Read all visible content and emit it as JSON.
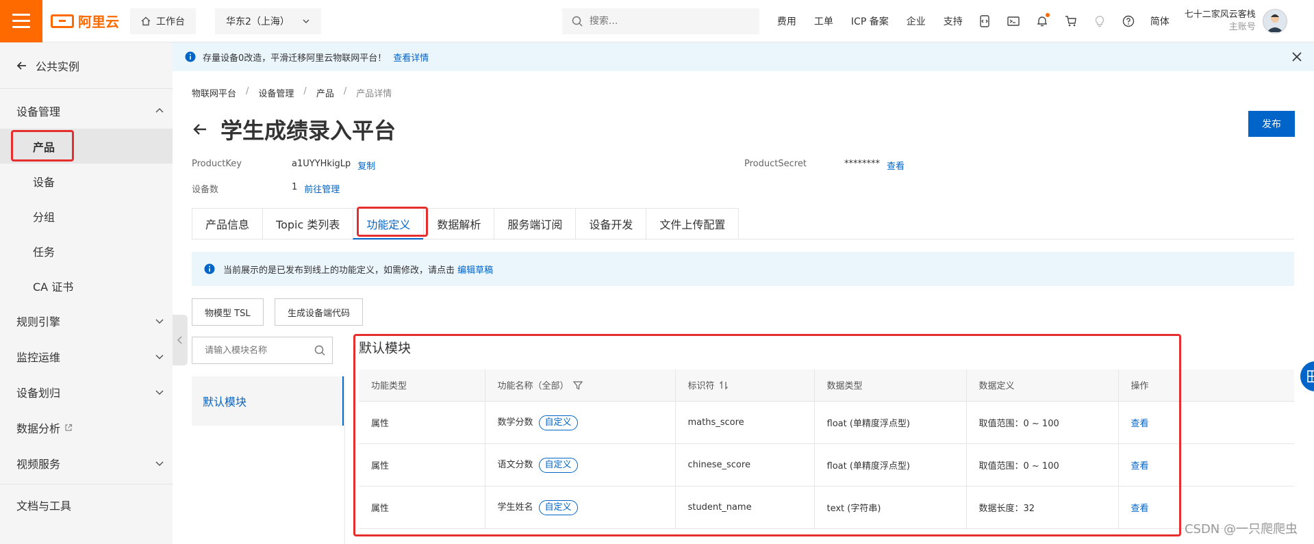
{
  "header": {
    "logo_text": "阿里云",
    "workbench_label": "工作台",
    "region_label": "华东2（上海）",
    "search_placeholder": "搜索...",
    "nav": [
      "费用",
      "工单",
      "ICP 备案",
      "企业",
      "支持"
    ],
    "lang_label": "简体",
    "account_name": "七十二家风云客栈",
    "account_sub": "主账号",
    "accent_color": "#ff6a00"
  },
  "sidebar": {
    "back_label": "公共实例",
    "device_mgmt": "设备管理",
    "items": [
      "产品",
      "设备",
      "分组",
      "任务",
      "CA 证书"
    ],
    "groups": [
      "规则引擎",
      "监控运维",
      "设备划归",
      "数据分析",
      "视频服务"
    ],
    "docs": "文档与工具"
  },
  "notice": {
    "text": "存量设备0改造，平滑迁移阿里云物联网平台！",
    "link": "查看详情"
  },
  "breadcrumb": [
    "物联网平台",
    "设备管理",
    "产品",
    "产品详情"
  ],
  "page": {
    "title": "学生成绩录入平台",
    "publish_label": "发布",
    "product_key_label": "ProductKey",
    "product_key_value": "a1UYYHkigLp",
    "copy_label": "复制",
    "product_secret_label": "ProductSecret",
    "product_secret_value": "********",
    "view_label": "查看",
    "device_count_label": "设备数",
    "device_count_value": "1",
    "manage_label": "前往管理"
  },
  "tabs": [
    "产品信息",
    "Topic 类列表",
    "功能定义",
    "数据解析",
    "服务端订阅",
    "设备开发",
    "文件上传配置"
  ],
  "active_tab": "功能定义",
  "info_box": {
    "text": "当前展示的是已发布到线上的功能定义，如需修改，请点击",
    "link": "编辑草稿"
  },
  "buttons": {
    "tsl": "物模型 TSL",
    "gen_code": "生成设备端代码"
  },
  "module_search_placeholder": "请输入模块名称",
  "module_item": "默认模块",
  "module_title": "默认模块",
  "table": {
    "headers": [
      "功能类型",
      "功能名称（全部）",
      "标识符",
      "数据类型",
      "数据定义",
      "操作"
    ],
    "rows": [
      {
        "type": "属性",
        "name": "数学分数",
        "tag": "自定义",
        "identifier": "maths_score",
        "data_type": "float (单精度浮点型)",
        "definition": "取值范围：0 ~ 100",
        "action": "查看"
      },
      {
        "type": "属性",
        "name": "语文分数",
        "tag": "自定义",
        "identifier": "chinese_score",
        "data_type": "float (单精度浮点型)",
        "definition": "取值范围：0 ~ 100",
        "action": "查看"
      },
      {
        "type": "属性",
        "name": "学生姓名",
        "tag": "自定义",
        "identifier": "student_name",
        "data_type": "text (字符串)",
        "definition": "数据长度：32",
        "action": "查看"
      }
    ]
  },
  "watermark": "CSDN @一只爬爬虫"
}
